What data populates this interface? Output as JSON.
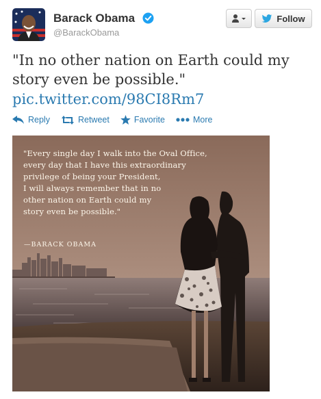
{
  "user": {
    "display_name": "Barack Obama",
    "handle": "@BarackObama",
    "verified": true
  },
  "buttons": {
    "follow_label": "Follow",
    "user_menu_icon": "user-dropdown-icon"
  },
  "tweet": {
    "text": "\"In no other nation on Earth could my story even be possible.\"",
    "link": "pic.twitter.com/98CI8Rm7"
  },
  "actions": [
    {
      "label": "Reply",
      "icon": "reply-icon"
    },
    {
      "label": "Retweet",
      "icon": "retweet-icon"
    },
    {
      "label": "Favorite",
      "icon": "star-icon"
    },
    {
      "label": "More",
      "icon": "more-dots-icon"
    }
  ],
  "photo": {
    "quote_lines": [
      "\"Every single day I walk into the Oval Office,",
      "every day that I have this extraordinary",
      "privilege of being your President,",
      "I will always remember that in no",
      "other nation on Earth could my",
      "story even be possible.\""
    ],
    "attribution": "—BARACK OBAMA"
  },
  "colors": {
    "link": "#2a7ab0",
    "twitter_blue": "#2ba6e1",
    "verified_blue": "#1da1f2"
  }
}
